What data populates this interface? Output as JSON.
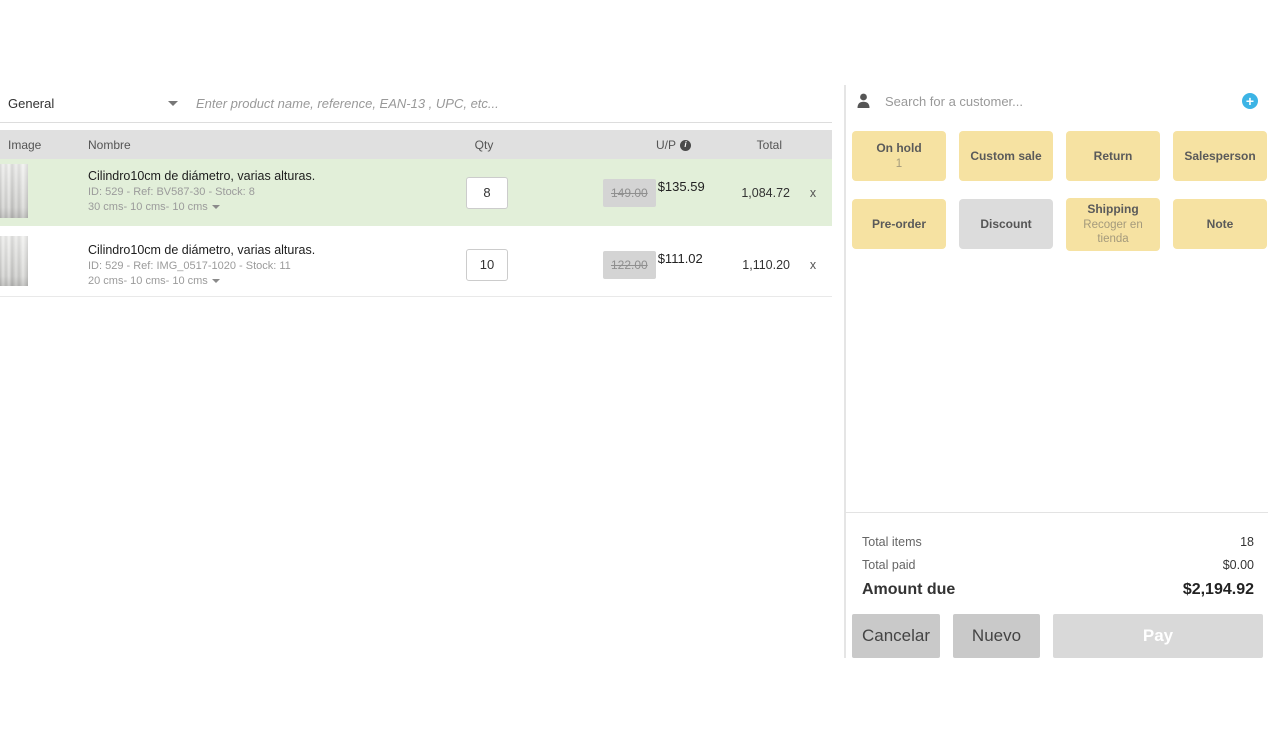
{
  "left": {
    "category_select": {
      "value": "General"
    },
    "product_search": {
      "placeholder": "Enter product name, reference, EAN-13 , UPC, etc..."
    },
    "table": {
      "headers": {
        "image": "Image",
        "name": "Nombre",
        "qty": "Qty",
        "unit_price": "U/P",
        "total": "Total"
      },
      "rows": [
        {
          "name": "Cilindro10cm de diámetro, varias alturas.",
          "meta": "ID: 529 - Ref: BV587-30 - Stock: 8",
          "variant": "30 cms- 10 cms- 10 cms",
          "qty": "8",
          "old_price": "149.00",
          "price": "$135.59",
          "total": "1,084.72",
          "remove_label": "x"
        },
        {
          "name": "Cilindro10cm de diámetro, varias alturas.",
          "meta": "ID: 529 - Ref: IMG_0517-1020 - Stock: 11",
          "variant": "20 cms- 10 cms- 10 cms",
          "qty": "10",
          "old_price": "122.00",
          "price": "$111.02",
          "total": "1,110.20",
          "remove_label": "x"
        }
      ]
    }
  },
  "right": {
    "customer_search": {
      "placeholder": "Search for a customer..."
    },
    "actions": [
      {
        "label": "On hold",
        "sub": "1"
      },
      {
        "label": "Custom sale"
      },
      {
        "label": "Return"
      },
      {
        "label": "Salesperson"
      },
      {
        "label": "Pre-order"
      },
      {
        "label": "Discount"
      },
      {
        "label": "Shipping",
        "sub": "Recoger en tienda"
      },
      {
        "label": "Note"
      }
    ],
    "totals": {
      "items_label": "Total items",
      "items_value": "18",
      "paid_label": "Total paid",
      "paid_value": "$0.00",
      "due_label": "Amount due",
      "due_value": "$2,194.92"
    },
    "footer": {
      "cancel": "Cancelar",
      "new": "Nuevo",
      "pay": "Pay"
    }
  },
  "icons": {
    "info_glyph": "i",
    "plus_glyph": "+"
  },
  "colors": {
    "action_yellow": "#f6e2a2",
    "action_gray": "#dcdcdc",
    "row_highlight_green": "#e2efd9",
    "table_header_gray": "#e0e0e0",
    "accent_blue": "#3cb4e5"
  }
}
